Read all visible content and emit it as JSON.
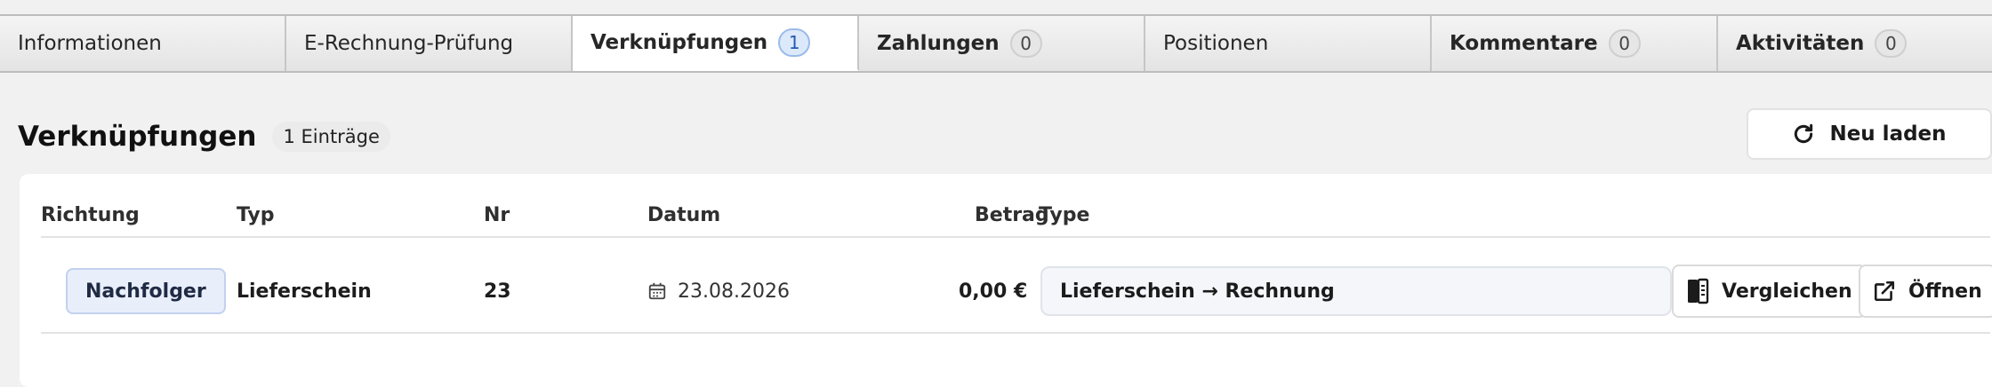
{
  "tabs": [
    {
      "label": "Informationen",
      "count": null
    },
    {
      "label": "E-Rechnung-Prüfung",
      "count": null
    },
    {
      "label": "Verknüpfungen",
      "count": "1"
    },
    {
      "label": "Zahlungen",
      "count": "0"
    },
    {
      "label": "Positionen",
      "count": null
    },
    {
      "label": "Kommentare",
      "count": "0"
    },
    {
      "label": "Aktivitäten",
      "count": "0"
    }
  ],
  "active_tab": "Verknüpfungen",
  "section": {
    "title": "Verknüpfungen",
    "entries_count": "1",
    "entries_label": "Einträge",
    "reload_label": "Neu laden"
  },
  "table": {
    "headers": {
      "direction": "Richtung",
      "type": "Typ",
      "number": "Nr",
      "date": "Datum",
      "amount": "Betrag",
      "link_type": "Type"
    },
    "rows": [
      {
        "direction": "Nachfolger",
        "type": "Lieferschein",
        "number": "23",
        "date": "23.08.2026",
        "amount": "0,00 €",
        "link_type": "Lieferschein → Rechnung",
        "compare_label": "Vergleichen",
        "open_label": "Öffnen"
      }
    ]
  },
  "icons": {
    "reload": "refresh-icon",
    "date": "calendar-icon",
    "compare": "compare-documents-icon",
    "open": "external-link-icon"
  },
  "colors": {
    "active_count_bg": "#dce9fb",
    "active_count_text": "#2458b3",
    "direction_badge_bg": "#e9eefb"
  }
}
